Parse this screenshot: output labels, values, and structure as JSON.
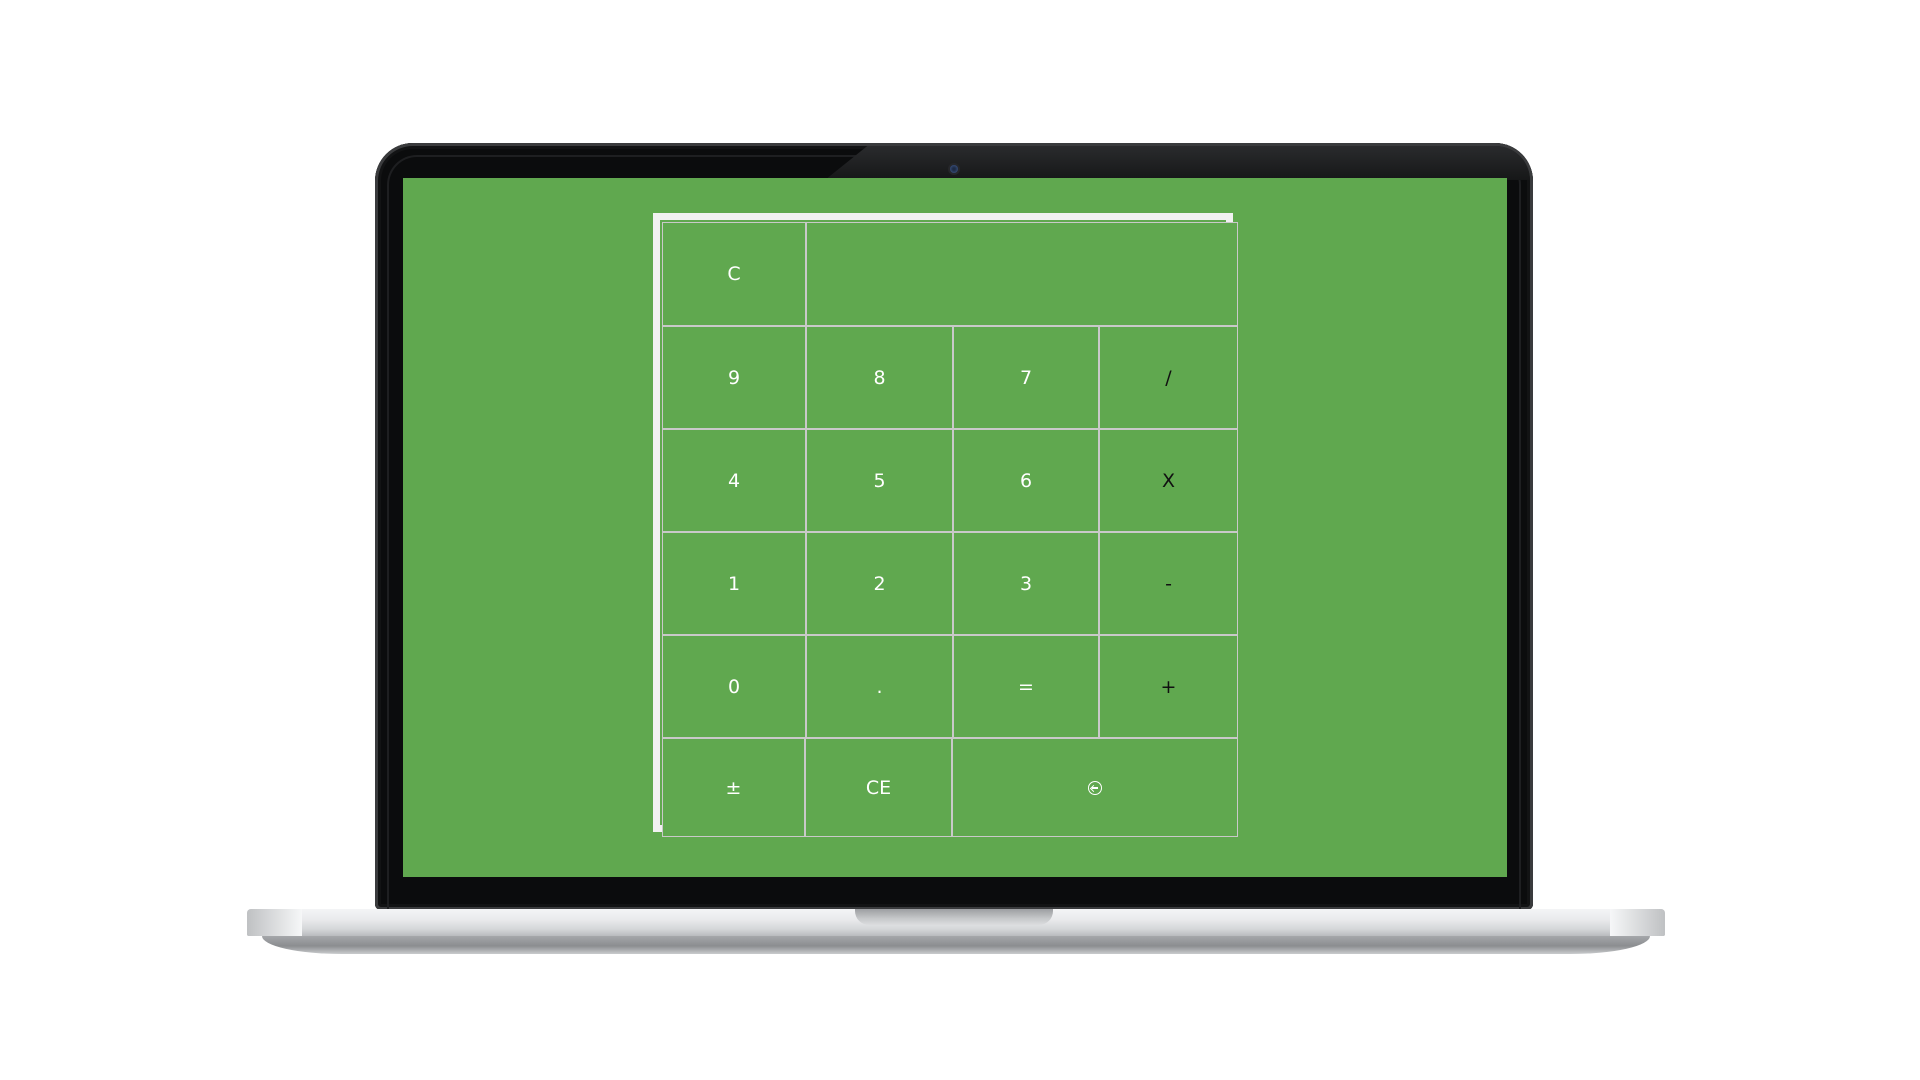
{
  "calculator": {
    "display_value": "",
    "keys": {
      "clear": "C",
      "nine": "9",
      "eight": "8",
      "seven": "7",
      "divide": "/",
      "four": "4",
      "five": "5",
      "six": "6",
      "multiply": "X",
      "one": "1",
      "two": "2",
      "three": "3",
      "subtract": "-",
      "zero": "0",
      "decimal": ".",
      "equals": "=",
      "add": "+",
      "plus_minus": "±",
      "clear_entry": "CE"
    },
    "backspace_icon": "backspace-circle-arrow-icon"
  },
  "colors": {
    "screen_background": "#60a84f",
    "calculator_border": "#f2f2f2",
    "key_divider": "#c9c9c9",
    "digit_text": "#ffffff",
    "operator_text": "#111111",
    "laptop_bezel": "#0b0c0d",
    "laptop_base": "#e9eaec"
  }
}
